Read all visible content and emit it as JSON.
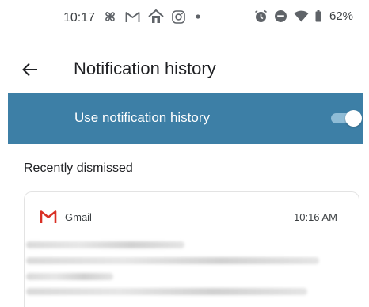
{
  "status_bar": {
    "time": "10:17",
    "left_icons": [
      "fan-icon",
      "gmail-icon",
      "home-icon",
      "instagram-icon",
      "dot-icon"
    ],
    "right_icons": [
      "alarm-icon",
      "dnd-icon",
      "wifi-icon",
      "battery-icon"
    ],
    "battery": "62%"
  },
  "app_bar": {
    "back_icon": "arrow-left-icon",
    "title": "Notification history"
  },
  "toggle": {
    "label": "Use notification history",
    "enabled": true,
    "bar_color": "#3d7fa6"
  },
  "section": {
    "title": "Recently dismissed"
  },
  "notification": {
    "app": "Gmail",
    "time": "10:16 AM",
    "icon": "gmail-icon",
    "content_blurred": true
  }
}
